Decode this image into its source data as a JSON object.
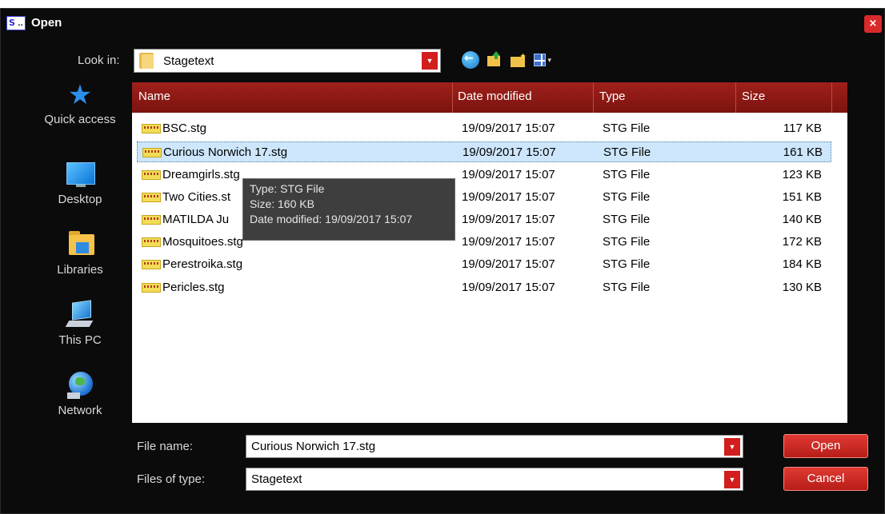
{
  "window": {
    "title": "Open",
    "app_icon_text": "S",
    "close_glyph": "×"
  },
  "look_in": {
    "label": "Look in:",
    "value": "Stagetext",
    "dropdown_glyph": "▼"
  },
  "toolbar": {
    "icons": [
      "back-arrow-icon",
      "up-folder-icon",
      "new-folder-icon",
      "view-menu-icon"
    ],
    "view_dropdown_glyph": "▾"
  },
  "places": [
    {
      "label": "Quick access",
      "icon": "quick-access-star-icon"
    },
    {
      "label": "Desktop",
      "icon": "desktop-icon"
    },
    {
      "label": "Libraries",
      "icon": "libraries-icon"
    },
    {
      "label": "This PC",
      "icon": "this-pc-icon"
    },
    {
      "label": "Network",
      "icon": "network-icon"
    }
  ],
  "columns": {
    "name": "Name",
    "date": "Date modified",
    "type": "Type",
    "size": "Size"
  },
  "files": [
    {
      "name": "BSC.stg",
      "date": "19/09/2017 15:07",
      "type": "STG File",
      "size": "117 KB"
    },
    {
      "name": "Curious Norwich 17.stg",
      "date": "19/09/2017 15:07",
      "type": "STG File",
      "size": "161 KB",
      "selected": true
    },
    {
      "name": "Dreamgirls.stg",
      "date": "19/09/2017 15:07",
      "type": "STG File",
      "size": "123 KB"
    },
    {
      "name": "Two Cities.st",
      "date": "19/09/2017 15:07",
      "type": "STG File",
      "size": "151 KB"
    },
    {
      "name": "MATILDA Ju",
      "date": "19/09/2017 15:07",
      "type": "STG File",
      "size": "140 KB"
    },
    {
      "name": "Mosquitoes.stg",
      "date": "19/09/2017 15:07",
      "type": "STG File",
      "size": "172 KB"
    },
    {
      "name": "Perestroika.stg",
      "date": "19/09/2017 15:07",
      "type": "STG File",
      "size": "184 KB"
    },
    {
      "name": "Pericles.stg",
      "date": "19/09/2017 15:07",
      "type": "STG File",
      "size": "130 KB"
    }
  ],
  "tooltip": {
    "type": "Type: STG File",
    "size": "Size: 160 KB",
    "date": "Date modified: 19/09/2017 15:07"
  },
  "file_name": {
    "label": "File name:",
    "value": "Curious Norwich 17.stg"
  },
  "file_type": {
    "label": "Files of type:",
    "value": "Stagetext"
  },
  "buttons": {
    "open": "Open",
    "cancel": "Cancel"
  },
  "colors": {
    "accent_red": "#b81d18",
    "header_red": "#8f1a15",
    "background": "#0b0b0b",
    "selection": "#cde6fb"
  }
}
